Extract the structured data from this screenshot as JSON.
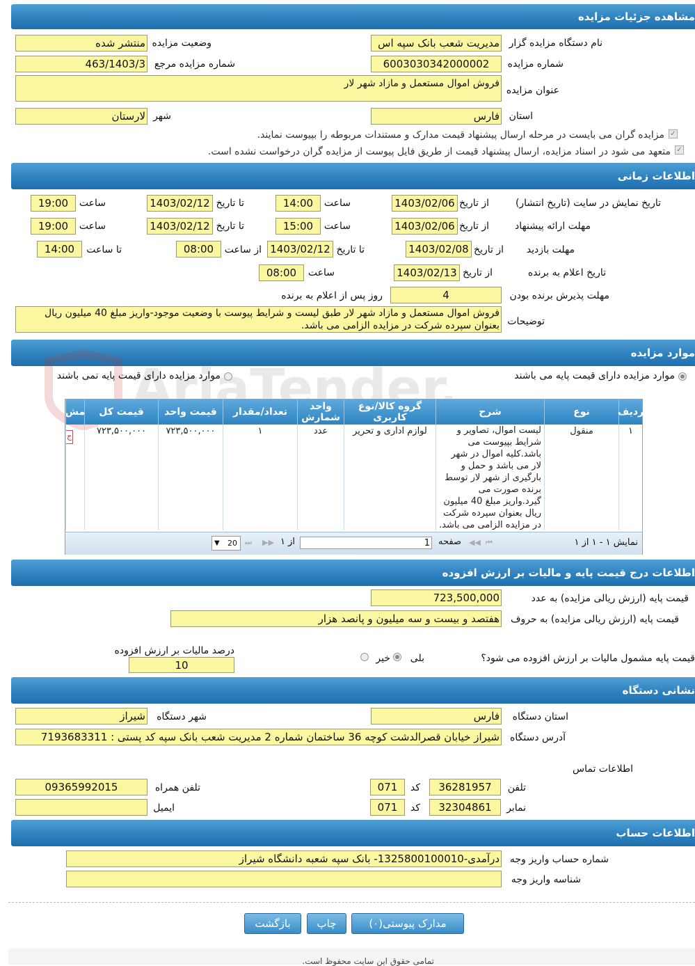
{
  "sections": {
    "details": "مشاهده جزئیات مزایده",
    "timing": "اطلاعات زمانی",
    "items": "موارد مزایده",
    "pricing": "اطلاعات درج قیمت پایه و مالیات بر ارزش افزوده",
    "device_address": "نشانی دستگاه",
    "account": "اطلاعات حساب"
  },
  "details": {
    "org_label": "نام دستگاه مزایده گزار",
    "org_value": "مدیریت شعب بانک سپه اس",
    "status_label": "وضعیت مزایده",
    "status_value": "منتشر شده",
    "number_label": "شماره مزایده",
    "number_value": "6003030342000002",
    "ref_label": "شماره مزایده مرجع",
    "ref_value": "463/1403/3",
    "title_label": "عنوان مزایده",
    "title_value": "فروش اموال مستعمل و مازاد شهر لار",
    "province_label": "استان",
    "province_value": "فارس",
    "city_label": "شهر",
    "city_value": "لارستان",
    "check1": "مزایده گران می بایست در مرحله ارسال پیشنهاد قیمت مدارک و مستندات مربوطه را بپیوست نمایند.",
    "check2": "متعهد می شود در اسناد مزایده، ارسال پیشنهاد قیمت از طریق فایل پیوست از مزایده گران درخواست نشده است."
  },
  "timing": {
    "display_label": "تاریخ نمایش در سایت (تاریخ انتشار)",
    "offer_label": "مهلت ارائه پیشنهاد",
    "visit_label": "مهلت بازدید",
    "winner_label": "تاریخ اعلام به برنده",
    "accept_label": "مهلت پذیرش برنده بودن",
    "notes_label": "توضیحات",
    "from_date": "از تاریخ",
    "to_date": "تا تاریخ",
    "time": "ساعت",
    "from_time": "از ساعت",
    "to_time": "تا ساعت",
    "display_from": "1403/02/06",
    "display_from_time": "14:00",
    "display_to": "1403/02/12",
    "display_to_time": "19:00",
    "offer_from": "1403/02/06",
    "offer_from_time": "15:00",
    "offer_to": "1403/02/12",
    "offer_to_time": "19:00",
    "visit_from": "1403/02/08",
    "visit_to": "1403/02/12",
    "visit_from_time": "08:00",
    "visit_to_time": "14:00",
    "winner_from": "1403/02/13",
    "winner_time": "08:00",
    "accept_days": "4",
    "accept_suffix": "روز پس از اعلام به برنده",
    "notes_value": "فروش اموال مستعمل و مازاد شهر لار طبق لیست و شرایط پیوست با وضعیت موجود-واریز مبلغ 40 میلیون ریال بعنوان سپرده شرکت در مزایده الزامی می باشد."
  },
  "items": {
    "radio_with_price": "موارد مزایده دارای قیمت پایه می باشند",
    "radio_without_price": "موارد مزایده دارای قیمت پایه نمی باشند",
    "headers": [
      "ردیف",
      "نوع",
      "شرح",
      "گروه کالا/نوع کاربری",
      "واحد شمارش",
      "تعداد/مقدار",
      "قیمت واحد",
      "قیمت کل",
      "مش"
    ],
    "row": {
      "index": "۱",
      "type": "منقول",
      "description": "لیست اموال، تصاویر و شرایط بپیوست می باشد.کلیه اموال در شهر لار می باشد و حمل و بارگیری از شهر لار توسط برنده صورت می گیرد.واریز مبلغ 40 میلیون ریال بعنوان سپرده شرکت در مزایده الزامی می باشد.",
      "group": "لوازم اداری و تحریر",
      "unit": "عدد",
      "qty": "۱",
      "unit_price": "۷۲۳,۵۰۰,۰۰۰",
      "total": "۷۲۳,۵۰۰,۰۰۰",
      "action": "ج"
    },
    "pager": {
      "showing": "نمایش ۱ - ۱ از ۱",
      "page_label": "صفحه",
      "page_value": "1",
      "of": "از ۱",
      "page_size": "20"
    }
  },
  "pricing": {
    "base_num_label": "قیمت پایه (ارزش ریالی مزایده) به عدد",
    "base_num_value": "723,500,000",
    "base_words_label": "قیمت پایه (ارزش ریالی مزایده) به حروف",
    "base_words_value": "هفتصد و بیست و سه میلیون و پانصد هزار",
    "vat_question": "قیمت پایه مشمول مالیات بر ارزش افزوده می شود؟",
    "yes": "بلی",
    "no": "خیر",
    "vat_percent_label": "درصد مالیات بر ارزش افزوده",
    "vat_percent_value": "10"
  },
  "device": {
    "province_label": "استان دستگاه",
    "province_value": "فارس",
    "city_label": "شهر دستگاه",
    "city_value": "شیراز",
    "address_label": "آدرس دستگاه",
    "address_value": "شیراز خیابان قصرالدشت کوچه 36 ساختمان شماره 2 مدیریت شعب بانک سپه کد پستی : 7193683311",
    "contact_label": "اطلاعات تماس",
    "phone_label": "تلفن",
    "phone_value": "36281957",
    "code_label": "کد",
    "phone_code": "071",
    "mobile_label": "تلفن همراه",
    "mobile_value": "09365992015",
    "fax_label": "نمابر",
    "fax_value": "32304861",
    "fax_code": "071",
    "email_label": "ایمیل",
    "email_value": ""
  },
  "account": {
    "number_label": "شماره حساب واریز وجه",
    "number_value": "درآمدی-1325800100010- بانک سپه شعبه دانشگاه شیراز",
    "id_label": "شناسه واریز وجه",
    "id_value": ""
  },
  "buttons": {
    "attachments": "مدارک پیوستی(۰)",
    "print": "چاپ",
    "back": "بازگشت"
  },
  "footer": "تمامی حقوق این سایت محفوظ است.",
  "watermark": "AriaTender.neT"
}
